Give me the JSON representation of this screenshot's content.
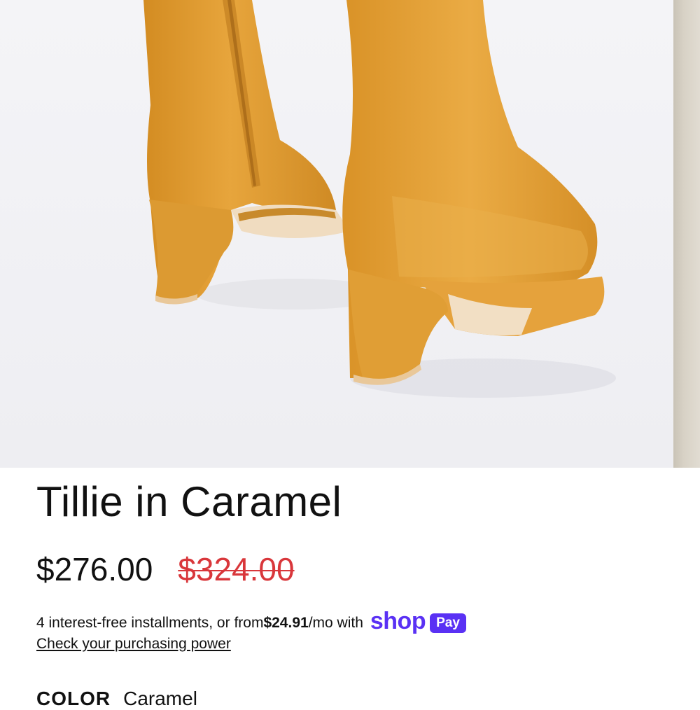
{
  "product": {
    "title": "Tillie in Caramel",
    "image": {
      "subject": "caramel-leather-platform-boots",
      "accent_color": "#E3A238"
    },
    "price": {
      "sale": "$276.00",
      "compare_at": "$324.00",
      "compare_color": "#D9373B"
    }
  },
  "installments": {
    "prefix": "4 interest-free installments, or from ",
    "amount": "$24.91",
    "suffix": "/mo with",
    "brand_word": "shop",
    "brand_badge": "Pay",
    "brand_color": "#5A31F4",
    "link": "Check your purchasing power"
  },
  "options": {
    "color_label": "COLOR",
    "color_value": "Caramel"
  }
}
